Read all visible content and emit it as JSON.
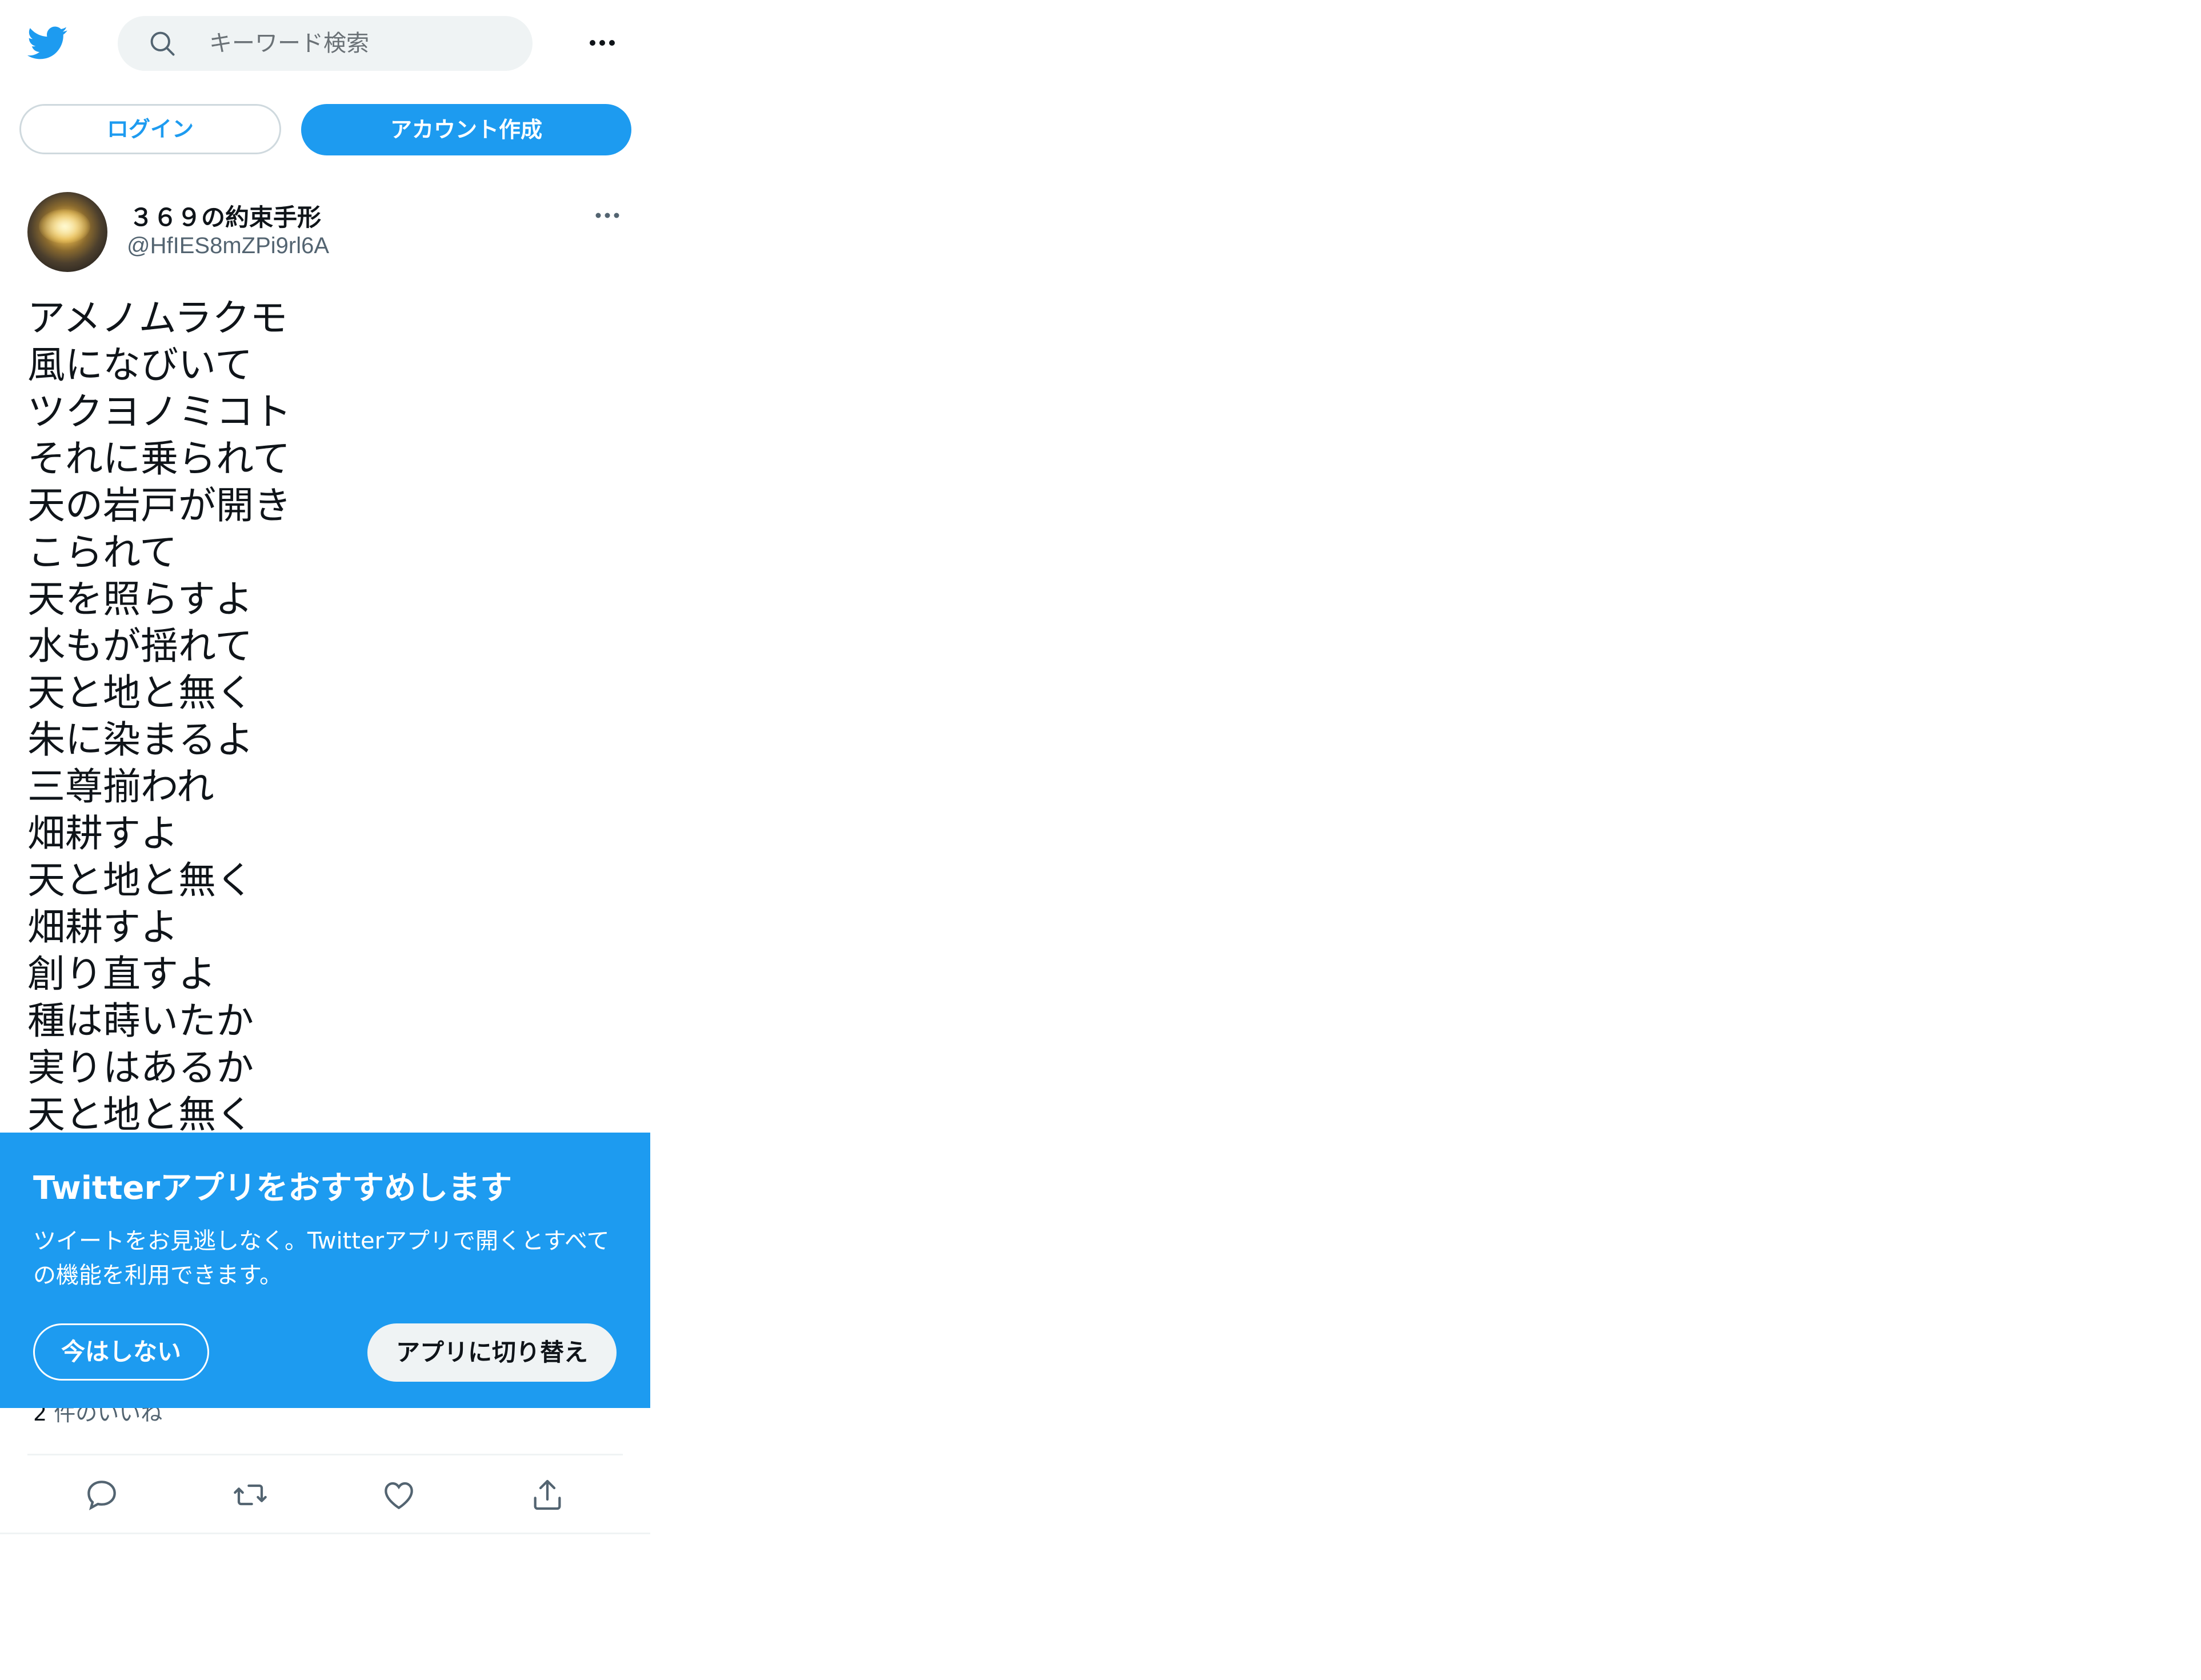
{
  "header": {
    "logo_icon": "twitter-bird-icon",
    "search": {
      "icon": "search-icon",
      "placeholder": "キーワード検索"
    },
    "more_icon": "more-horizontal-icon"
  },
  "auth": {
    "login_label": "ログイン",
    "signup_label": "アカウント作成"
  },
  "tweet": {
    "author": {
      "display_name": "３６９の約束手形",
      "handle": "@HfIES8mZPi9rl6A"
    },
    "text_lines": [
      "アメノムラクモ",
      "風になびいて",
      "ツクヨノミコト",
      "それに乗られて",
      "天の岩戸が開き",
      "こられて",
      "天を照らすよ",
      "水もが揺れて",
      "天と地と無く",
      "朱に染まるよ",
      "三尊揃われ",
      "畑耕すよ",
      "天と地と無く",
      "畑耕すよ",
      "創り直すよ",
      "種は蒔いたか",
      "実りはあるか",
      "天と地と無く"
    ],
    "likes": {
      "count": "2",
      "label": "件のいいね"
    },
    "actions": [
      "reply-icon",
      "retweet-icon",
      "like-icon",
      "share-icon"
    ]
  },
  "promo": {
    "title": "Twitterアプリをおすすめします",
    "body": "ツイートをお見逃しなく。Twitterアプリで開くとすべての機能を利用できます。",
    "not_now_label": "今はしない",
    "switch_label": "アプリに切り替え"
  },
  "colors": {
    "accent": "#1d9bf0",
    "text": "#0f1419",
    "secondary_text": "#536471",
    "search_bg": "#eff3f4"
  }
}
